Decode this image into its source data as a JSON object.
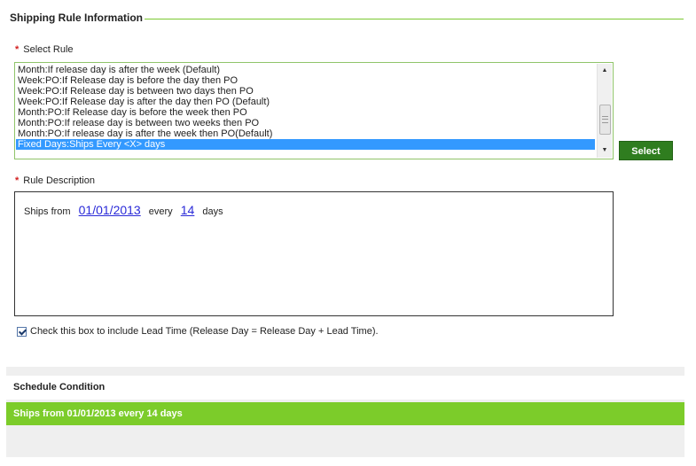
{
  "section": {
    "title": "Shipping Rule Information"
  },
  "select_rule": {
    "required_marker": "*",
    "label": "Select Rule",
    "options": [
      "Month:If release day is after the week (Default)",
      "Week:PO:If Release day is before the day then PO",
      "Week:PO:If Release day is between two days then PO",
      "Week:PO:If Release day is after the day then PO (Default)",
      "Month:PO:If Release day is before the week then PO",
      "Month:PO:If release day is between two weeks then PO",
      "Month:PO:If release day is after the week then PO(Default)",
      "Fixed Days:Ships Every <X> days"
    ],
    "selected_index": 7,
    "scroll_up_icon": "▲",
    "scroll_down_icon": "▼",
    "button_label": "Select"
  },
  "rule_description": {
    "required_marker": "*",
    "label": "Rule Description",
    "text_ships_from": "Ships from",
    "date_link": "01/01/2013",
    "text_every": "every",
    "days_link": "14",
    "text_days": "days"
  },
  "lead_time": {
    "checked": true,
    "label": "Check this box to include Lead Time (Release Day = Release Day + Lead Time)."
  },
  "schedule": {
    "title": "Schedule Condition",
    "condition": "Ships from 01/01/2013 every 14 days"
  },
  "colors": {
    "accent_green": "#7ccc2a",
    "button_green": "#2f7d1f",
    "selection_blue": "#3399ff",
    "link_blue": "#2a2ad8",
    "required_red": "#d21f1f"
  }
}
